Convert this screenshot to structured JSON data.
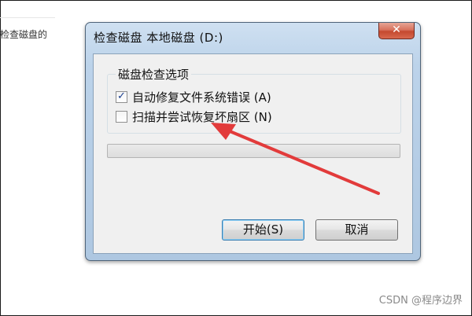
{
  "background": {
    "left_text": "检查磁盘的",
    "watermark": "CSDN @程序边界"
  },
  "dialog": {
    "title": "检查磁盘 本地磁盘 (D:)",
    "close_label": "✕",
    "group_title": "磁盘检查选项",
    "options": [
      {
        "label": "自动修复文件系统错误 (A)",
        "checked": true
      },
      {
        "label": "扫描并尝试恢复坏扇区 (N)",
        "checked": false
      }
    ],
    "progress": 0,
    "buttons": {
      "start": "开始(S)",
      "cancel": "取消"
    }
  },
  "colors": {
    "window_frame": "#bcd3ea",
    "close_button": "#c5492f",
    "annotation_arrow": "#e23b3b"
  },
  "icons": {
    "checkbox_checked": "check-mark",
    "annotation": "red-arrow"
  }
}
